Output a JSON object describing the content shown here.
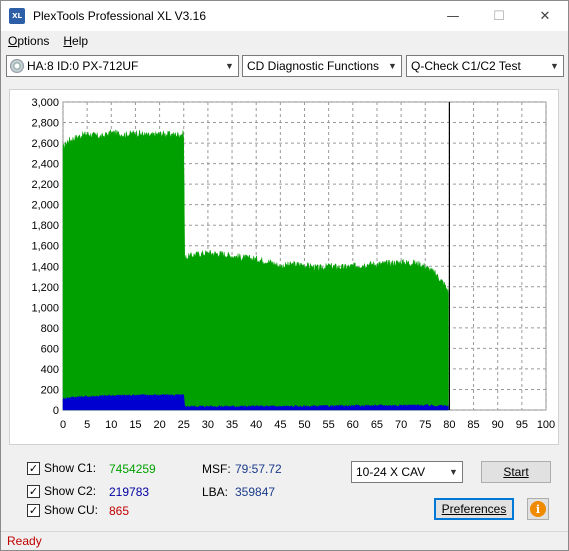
{
  "window": {
    "title": "PlexTools Professional XL V3.16",
    "icon_label": "XL"
  },
  "menu": [
    {
      "label": "Options",
      "u": "O",
      "rest": "ptions"
    },
    {
      "label": "Help",
      "u": "H",
      "rest": "elp"
    }
  ],
  "toolbar": {
    "drive": "HA:8 ID:0  PX-712UF",
    "function": "CD Diagnostic Functions",
    "test": "Q-Check C1/C2 Test"
  },
  "chart_data": {
    "type": "area",
    "title": "",
    "xlabel": "",
    "ylabel": "",
    "xlim": [
      0,
      100
    ],
    "ylim": [
      0,
      3000
    ],
    "x_ticks": [
      0,
      5,
      10,
      15,
      20,
      25,
      30,
      35,
      40,
      45,
      50,
      55,
      60,
      65,
      70,
      75,
      80,
      85,
      90,
      95,
      100
    ],
    "y_ticks": [
      0,
      200,
      400,
      600,
      800,
      1000,
      1200,
      1400,
      1600,
      1800,
      2000,
      2200,
      2400,
      2600,
      2800,
      3000
    ],
    "y_tick_labels": [
      "0",
      "200",
      "400",
      "600",
      "800",
      "1,000",
      "1,200",
      "1,400",
      "1,600",
      "1,800",
      "2,000",
      "2,200",
      "2,400",
      "2,600",
      "2,800",
      "3,000"
    ],
    "grid": true,
    "end_marker_x": 80,
    "series": [
      {
        "name": "C1",
        "color": "#00a000",
        "x": [
          0,
          1,
          3,
          5,
          8,
          10,
          13,
          15,
          18,
          20,
          23,
          25,
          25.2,
          27,
          30,
          33,
          35,
          38,
          40,
          43,
          45,
          48,
          50,
          53,
          55,
          58,
          60,
          63,
          65,
          68,
          70,
          73,
          75,
          77,
          78,
          79,
          79.8
        ],
        "y": [
          2550,
          2620,
          2660,
          2690,
          2660,
          2700,
          2680,
          2700,
          2670,
          2690,
          2680,
          2690,
          1480,
          1510,
          1530,
          1520,
          1500,
          1480,
          1470,
          1440,
          1400,
          1420,
          1410,
          1380,
          1400,
          1390,
          1400,
          1420,
          1420,
          1430,
          1440,
          1430,
          1400,
          1330,
          1280,
          1220,
          1150
        ]
      },
      {
        "name": "C2",
        "color": "#0000d0",
        "x": [
          0,
          2,
          5,
          10,
          15,
          20,
          25,
          25.2,
          30,
          40,
          50,
          60,
          70,
          75,
          79.8
        ],
        "y": [
          110,
          125,
          130,
          140,
          145,
          145,
          145,
          35,
          35,
          35,
          35,
          40,
          45,
          45,
          40
        ]
      }
    ]
  },
  "stats": {
    "show_c1": "Show C1:",
    "c1_value": "7454259",
    "show_c2": "Show C2:",
    "c2_value": "219783",
    "show_cu": "Show CU:",
    "cu_value": "865",
    "msf_label": "MSF:",
    "msf_value": "79:57.72",
    "lba_label": "LBA:",
    "lba_value": "359847",
    "speed": "10-24 X CAV",
    "start": "Start",
    "preferences": "Preferences",
    "c1_color": "#00a000",
    "c2_color": "#0000a0",
    "cu_color": "#c00000",
    "info_color": "#1a3a8a"
  },
  "status": "Ready"
}
